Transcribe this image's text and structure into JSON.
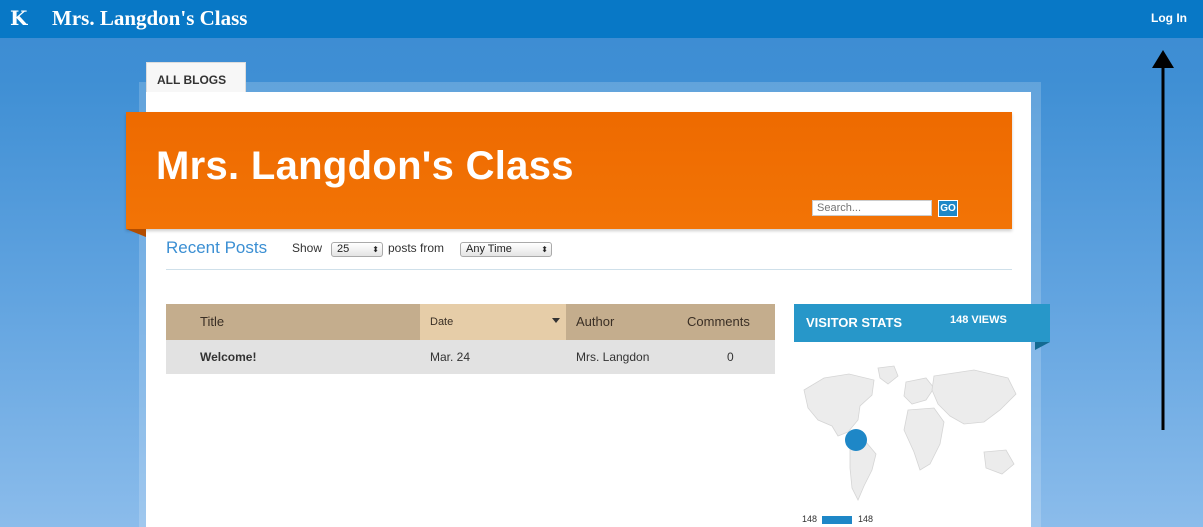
{
  "topbar": {
    "logo": "K",
    "title": "Mrs. Langdon's Class",
    "login": "Log In"
  },
  "tabs": {
    "all_blogs": "ALL BLOGS"
  },
  "banner": {
    "title": "Mrs. Langdon's Class",
    "search_placeholder": "Search...",
    "go_label": "GO"
  },
  "recent": {
    "title": "Recent Posts",
    "show_label": "Show",
    "count_value": "25",
    "posts_from_label": "posts from",
    "time_value": "Any Time"
  },
  "table": {
    "headers": {
      "title": "Title",
      "date": "Date",
      "author": "Author",
      "comments": "Comments"
    },
    "rows": [
      {
        "title": "Welcome!",
        "date": "Mar. 24",
        "author": "Mrs. Langdon",
        "comments": "0"
      }
    ]
  },
  "stats": {
    "title": "VISITOR STATS",
    "views": "148 VIEWS",
    "legend_min": "148",
    "legend_max": "148"
  },
  "colors": {
    "topbar": "#0878c6",
    "banner": "#ef6c00",
    "accent": "#2797c9",
    "table_header": "#c4ad8d"
  }
}
